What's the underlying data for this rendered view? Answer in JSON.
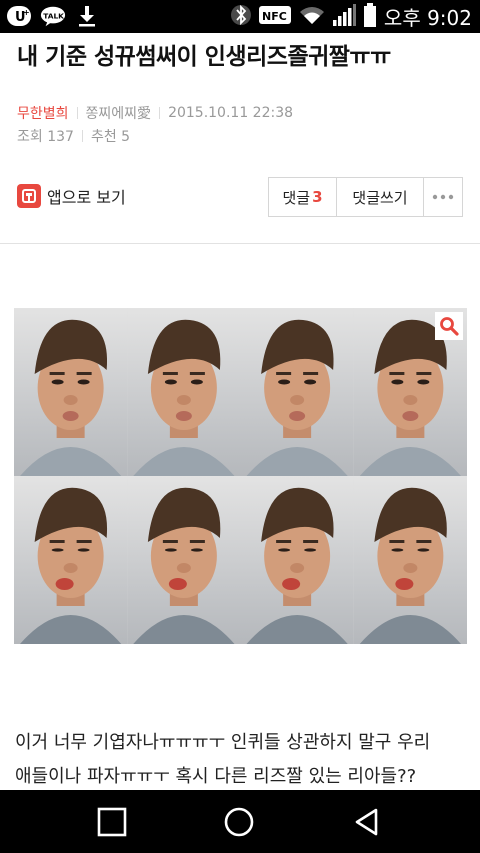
{
  "status_bar": {
    "left_icons": [
      "uplus-icon",
      "talk-icon",
      "download-icon"
    ],
    "right_icons": [
      "bluetooth-icon",
      "nfc-icon",
      "wifi-icon",
      "signal-icon",
      "battery-icon"
    ],
    "nfc_text": "NFC",
    "talk_text": "TALK",
    "time": "오후 9:02"
  },
  "post": {
    "title": "내 기준 성뀨썸써이 인생리즈졸귀짤ㅠㅠ",
    "category": "무한별희",
    "author": "쫑찌에찌愛",
    "date": "2015.10.11 22:38",
    "views": "조회 137",
    "recommend": "추천 5"
  },
  "toolbar": {
    "app_view_label": "앱으로 보기",
    "comment_label": "댓글",
    "comment_count": "3",
    "write_comment_label": "댓글쓰기",
    "more_label": "···"
  },
  "image": {
    "alt": "",
    "zoom_icon": "search-icon"
  },
  "body": {
    "lines": [
      "이거 너무 기엽자나ㅠㅠㅠㅜ 인퀴들 상관하지 말구 우리",
      "애들이나 파자ㅠㅠㅜ 혹시 다른 리즈짤 있는 리아들??"
    ]
  },
  "nav_bar": {
    "buttons": [
      "recent-apps-icon",
      "home-icon",
      "back-icon"
    ]
  },
  "colors": {
    "accent": "#e8483f",
    "status_bar_bg": "#000000",
    "nav_bar_bg": "#000000"
  }
}
